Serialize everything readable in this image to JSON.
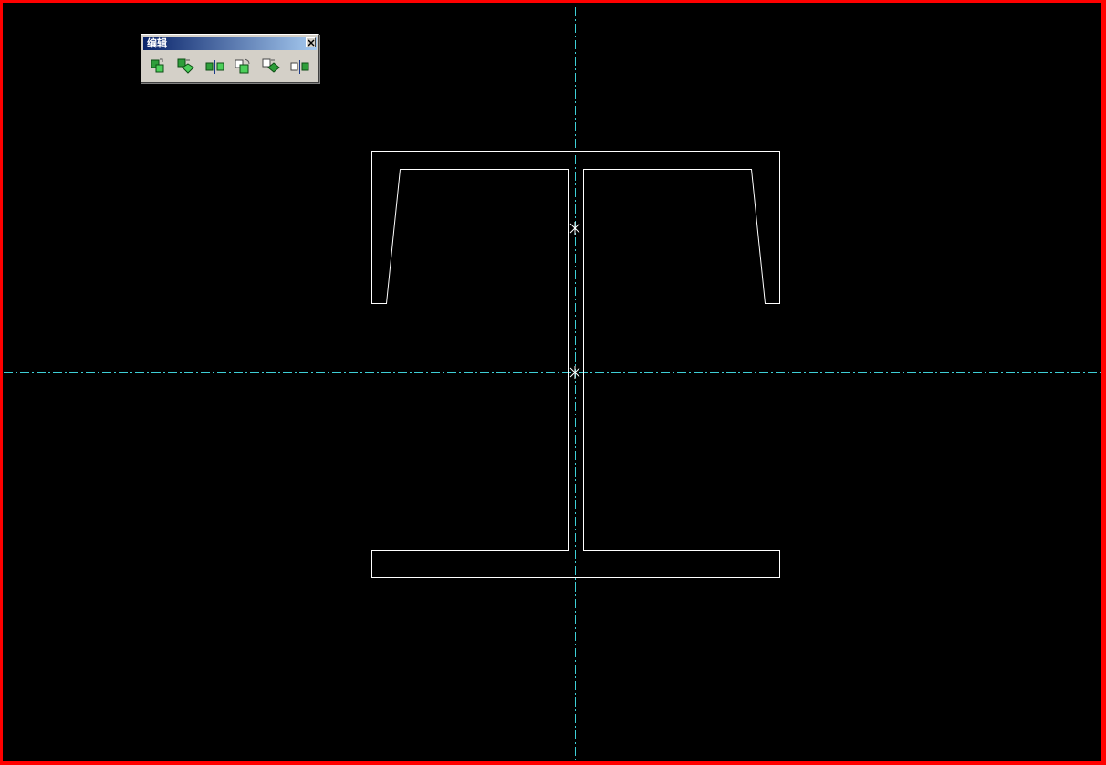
{
  "canvas": {
    "background": "#000000",
    "frame_color": "#ff0000",
    "centerline_color": "#3ecfd6",
    "geometry_color": "#ffffff"
  },
  "toolbar": {
    "title": "编辑",
    "close_icon": "close-icon",
    "buttons": [
      {
        "icon": "copy-objects-icon"
      },
      {
        "icon": "move-objects-icon"
      },
      {
        "icon": "mirror-objects-icon"
      },
      {
        "icon": "rotate-objects-icon"
      },
      {
        "icon": "scale-objects-icon"
      },
      {
        "icon": "mirror-copy-icon"
      }
    ]
  }
}
